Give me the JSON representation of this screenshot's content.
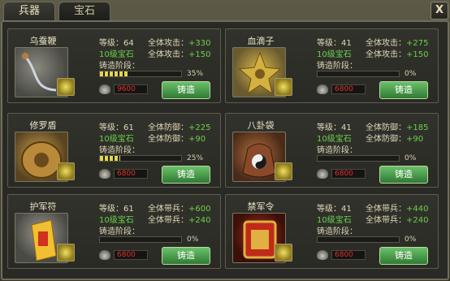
{
  "tabs": {
    "weapons": "兵器",
    "gems": "宝石"
  },
  "close_label": "X",
  "labels": {
    "level": "等级：",
    "attack": "全体攻击：",
    "defense": "全体防御：",
    "troops": "全体带兵：",
    "gem": "10级宝石",
    "stage": "铸造阶段：",
    "forge": "铸造"
  },
  "cards": [
    {
      "name": "乌蚕鞭",
      "level": "64",
      "stat_type": "attack",
      "stat1": "+330",
      "stat2": "+150",
      "progress": 0.35,
      "pct": "35%",
      "cost": "9600"
    },
    {
      "name": "血滴子",
      "level": "41",
      "stat_type": "attack",
      "stat1": "+275",
      "stat2": "+150",
      "progress": 0.0,
      "pct": "0%",
      "cost": "6800"
    },
    {
      "name": "修罗盾",
      "level": "61",
      "stat_type": "defense",
      "stat1": "+225",
      "stat2": "+90",
      "progress": 0.25,
      "pct": "25%",
      "cost": "6800"
    },
    {
      "name": "八卦袋",
      "level": "41",
      "stat_type": "defense",
      "stat1": "+185",
      "stat2": "+90",
      "progress": 0.0,
      "pct": "0%",
      "cost": "6800"
    },
    {
      "name": "护军符",
      "level": "61",
      "stat_type": "troops",
      "stat1": "+600",
      "stat2": "+240",
      "progress": 0.0,
      "pct": "0%",
      "cost": "6800"
    },
    {
      "name": "禁军令",
      "level": "41",
      "stat_type": "troops",
      "stat1": "+440",
      "stat2": "+240",
      "progress": 0.0,
      "pct": "0%",
      "cost": "6800"
    }
  ],
  "colors": {
    "bonus": "#6bd04a",
    "cost": "#e0302a",
    "forge_button": "#3d9a3f"
  }
}
